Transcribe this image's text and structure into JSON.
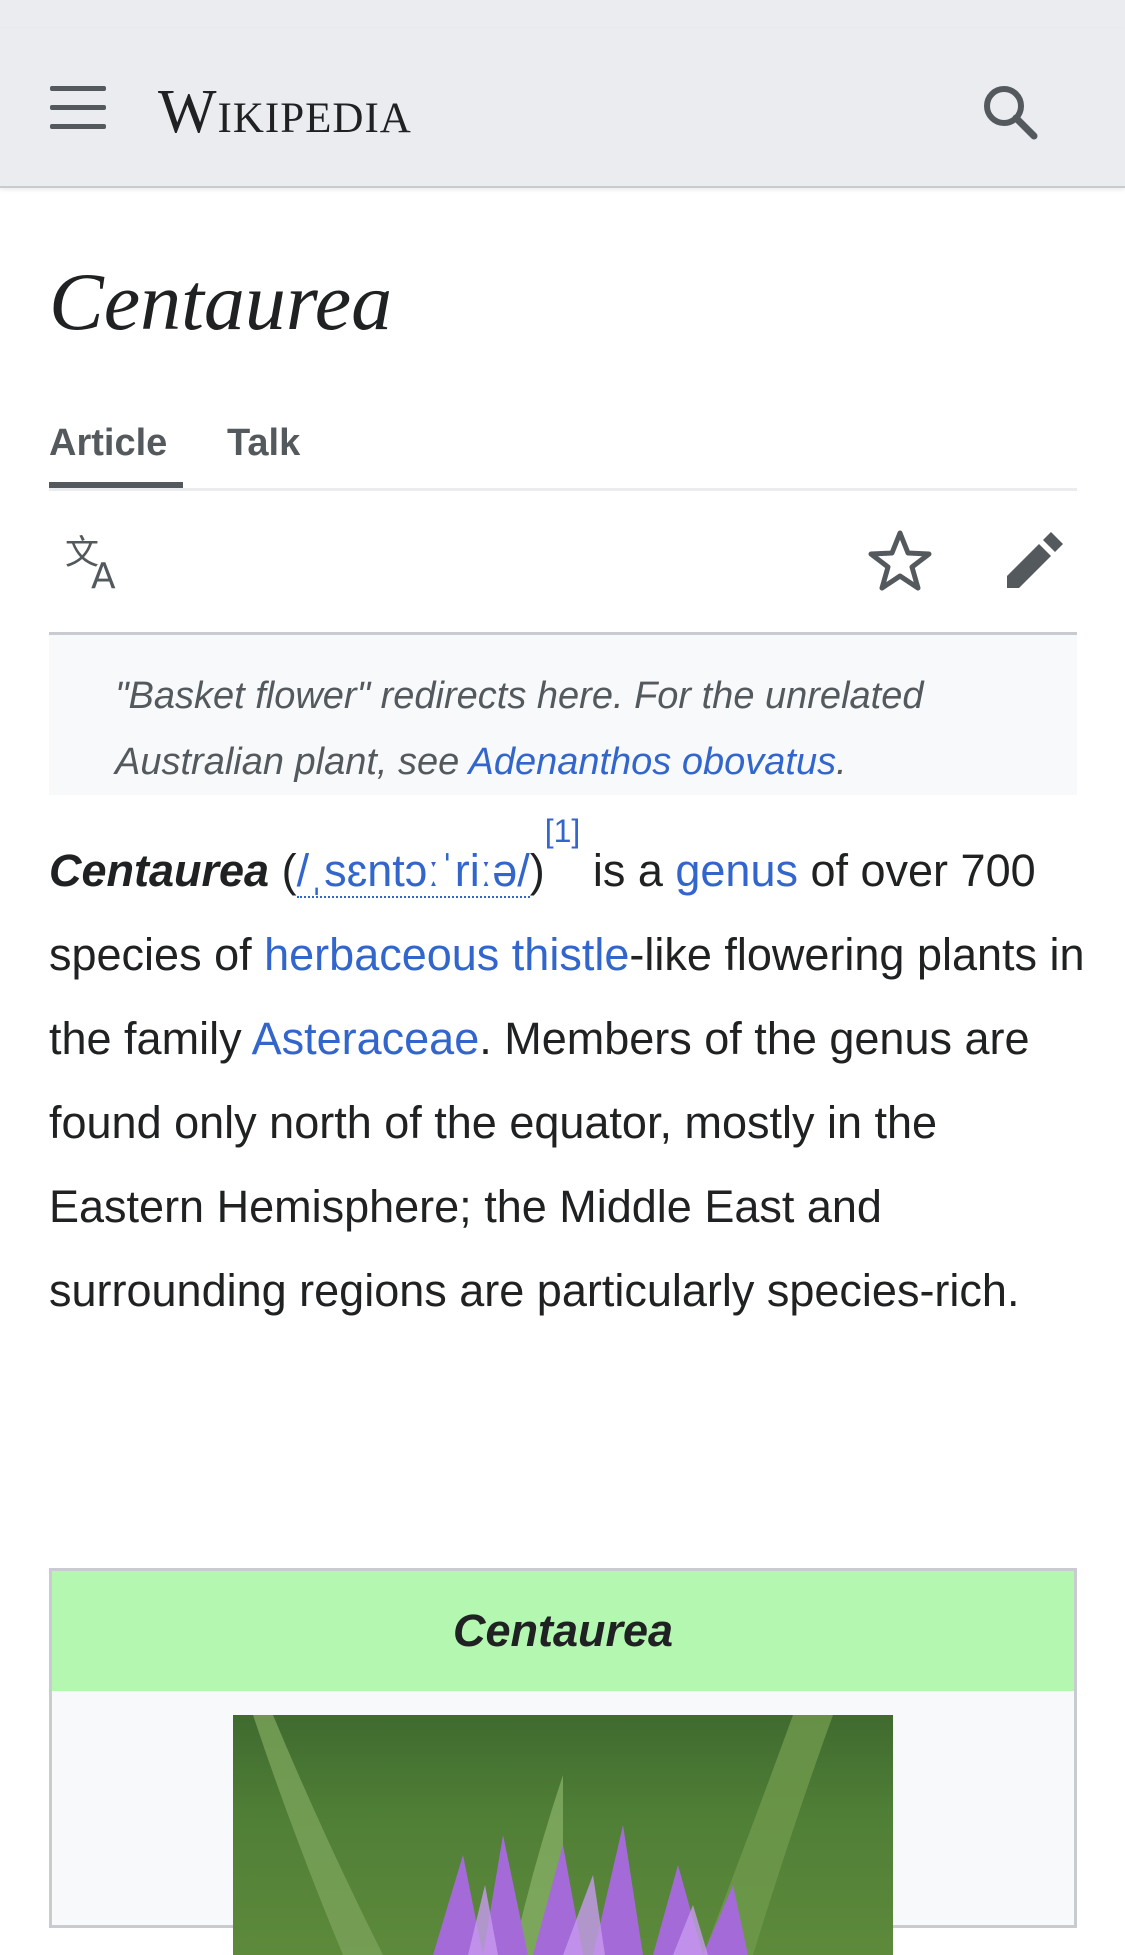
{
  "header": {
    "logo_text": "Wikipedia",
    "menu_icon": "hamburger-menu-icon",
    "search_icon": "search-icon"
  },
  "page": {
    "title": "Centaurea"
  },
  "tabs": [
    {
      "label": "Article",
      "active": true
    },
    {
      "label": "Talk",
      "active": false
    }
  ],
  "actions": {
    "language_icon": "language-icon",
    "watch_icon": "star-icon",
    "edit_icon": "pencil-icon"
  },
  "hatnote": {
    "text_before": "\"Basket flower\" redirects here. For the unrelated Australian plant, see ",
    "link": "Adenanthos obovatus",
    "text_after": "."
  },
  "lead": {
    "bold_term": "Centaurea",
    "paren_open": " (",
    "ipa": "/ˌsɛntɔːˈriːə/",
    "paren_close": ")",
    "ref": "[1]",
    "t1": " is a ",
    "link_genus": "genus",
    "t2": " of over 700 species of ",
    "link_thistle": "herbaceous thistle",
    "t3": "-like flowering plants in the family ",
    "link_asteraceae": "Asteraceae",
    "t4": ". Members of the genus are found only north of the equator, mostly in the Eastern Hemisphere; the Middle East and surrounding regions are particularly species-rich."
  },
  "infobox": {
    "title": "Centaurea"
  },
  "colors": {
    "header_bg": "#eaecf0",
    "link": "#3366cc",
    "infobox_title_bg": "#b3f7b1"
  }
}
